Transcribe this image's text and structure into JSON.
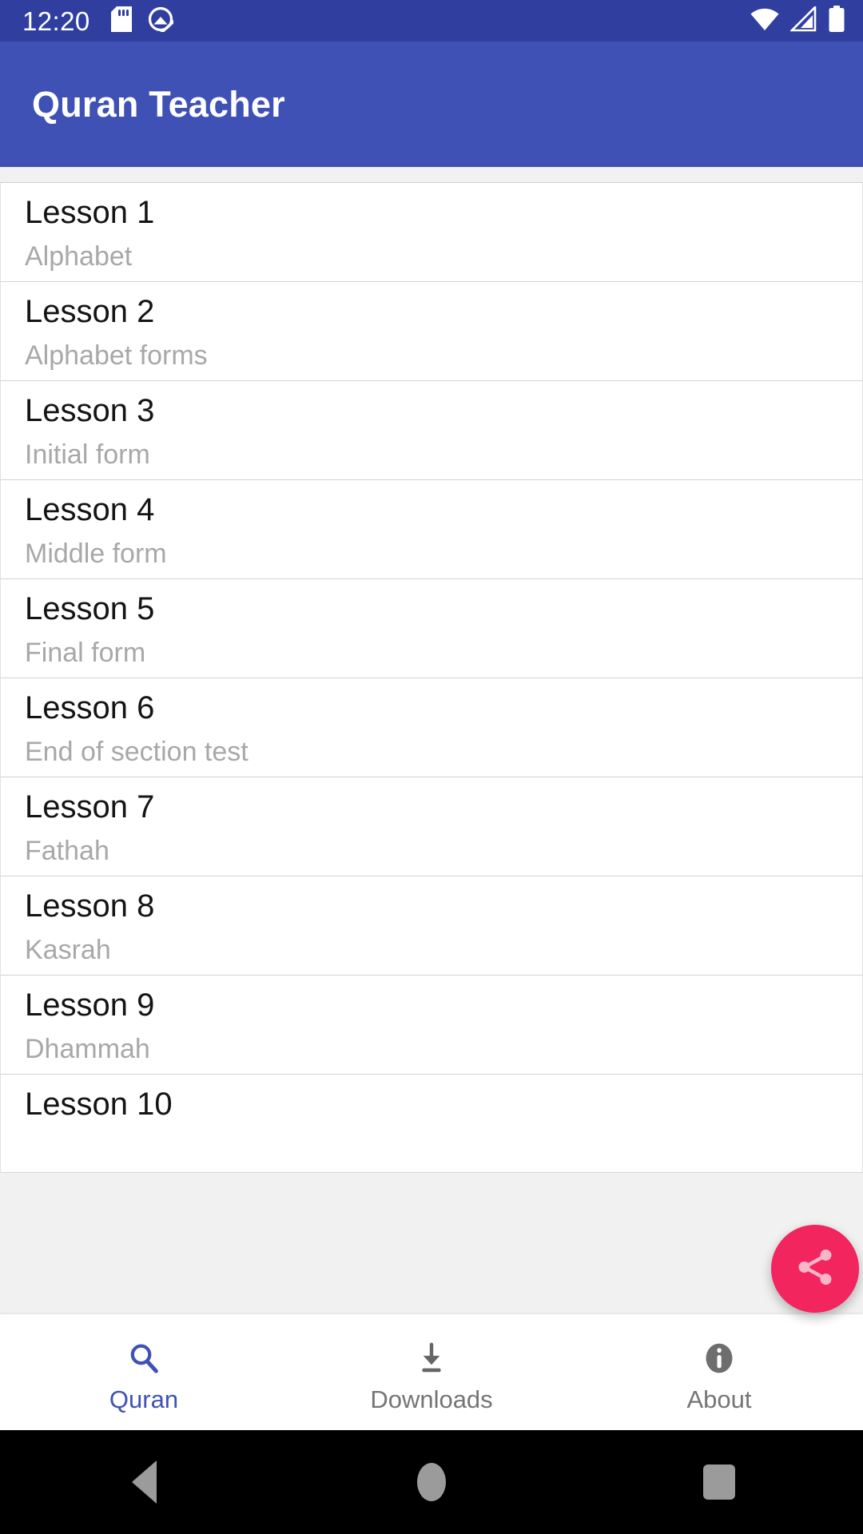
{
  "status_bar": {
    "time": "12:20",
    "left_icons": [
      "sd-card-icon",
      "do-not-disturb-icon"
    ],
    "right_icons": [
      "wifi-icon",
      "cellular-signal-icon",
      "battery-full-icon"
    ],
    "background_color": "#303f9f"
  },
  "app_bar": {
    "title": "Quran Teacher",
    "background_color": "#3f51b5",
    "text_color": "#ffffff"
  },
  "lessons": [
    {
      "title": "Lesson 1",
      "subtitle": "Alphabet"
    },
    {
      "title": "Lesson 2",
      "subtitle": "Alphabet forms"
    },
    {
      "title": "Lesson 3",
      "subtitle": "Initial form"
    },
    {
      "title": "Lesson 4",
      "subtitle": "Middle form"
    },
    {
      "title": "Lesson 5",
      "subtitle": "Final form"
    },
    {
      "title": "Lesson 6",
      "subtitle": "End of section test"
    },
    {
      "title": "Lesson 7",
      "subtitle": "Fathah"
    },
    {
      "title": "Lesson 8",
      "subtitle": "Kasrah"
    },
    {
      "title": "Lesson 9",
      "subtitle": "Dhammah"
    },
    {
      "title": "Lesson 10",
      "subtitle": ""
    }
  ],
  "fab": {
    "icon": "share-icon",
    "background_color": "#f2255e"
  },
  "bottom_nav": {
    "active_color": "#3f51b5",
    "inactive_color": "#757575",
    "tabs": [
      {
        "label": "Quran",
        "icon": "search-icon",
        "active": true
      },
      {
        "label": "Downloads",
        "icon": "download-icon",
        "active": false
      },
      {
        "label": "About",
        "icon": "info-icon",
        "active": false
      }
    ]
  },
  "system_nav": {
    "buttons": [
      "back-button",
      "home-button",
      "recents-button"
    ]
  }
}
